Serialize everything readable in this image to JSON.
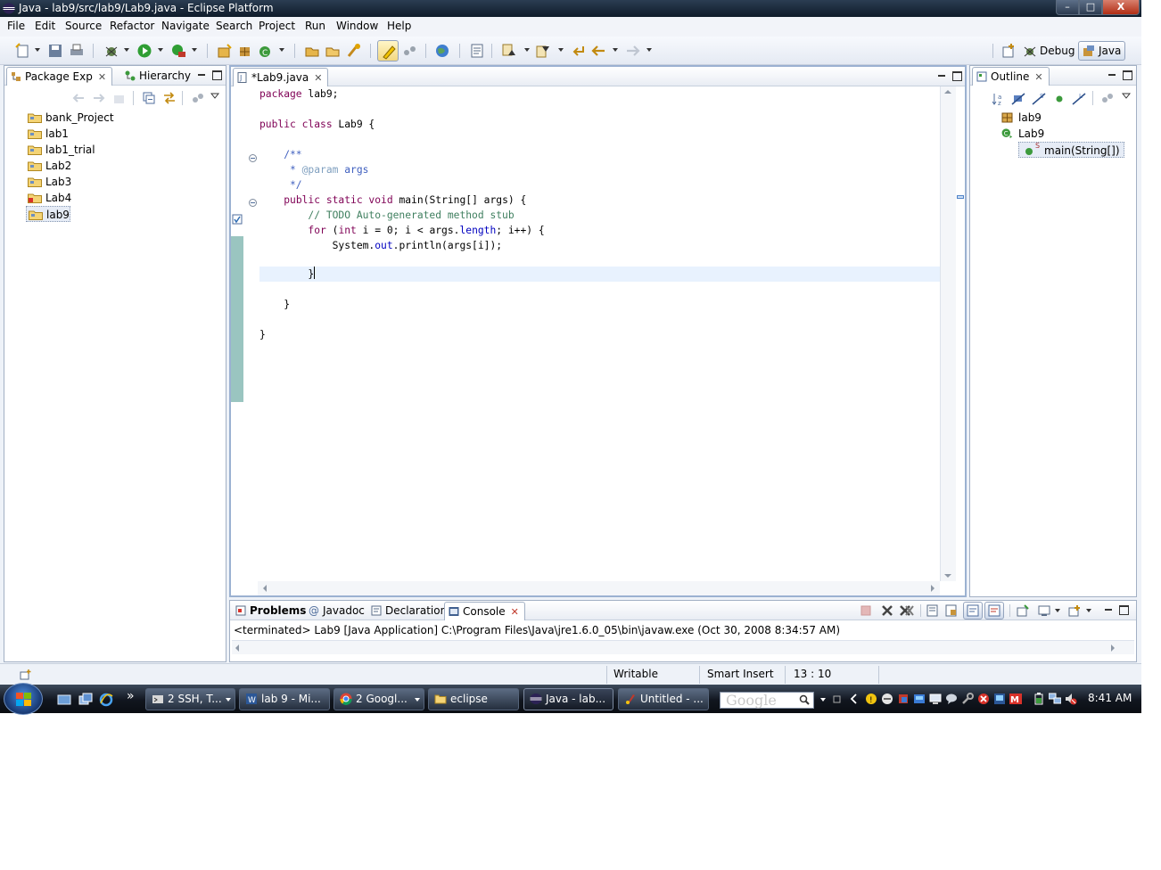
{
  "window": {
    "title": "Java - lab9/src/lab9/Lab9.java - Eclipse Platform",
    "controls": {
      "minimize": "–",
      "maximize": "□",
      "close": "X"
    }
  },
  "menu": [
    "File",
    "Edit",
    "Source",
    "Refactor",
    "Navigate",
    "Search",
    "Project",
    "Run",
    "Window",
    "Help"
  ],
  "perspectives": {
    "debug": "Debug",
    "java": "Java"
  },
  "package_explorer": {
    "tabs": [
      "Package Exp",
      "Hierarchy"
    ],
    "close_glyph": "✕",
    "projects": [
      "bank_Project",
      "lab1",
      "lab1_trial",
      "Lab2",
      "Lab3",
      "Lab4",
      "lab9"
    ],
    "selected": "lab9"
  },
  "editor": {
    "tab": "*Lab9.java",
    "close_glyph": "✕",
    "lines": {
      "l1_kw": "package",
      "l1_rest": " lab9;",
      "l3_kw": "public class",
      "l3_rest": " Lab9 {",
      "l5": "    /**",
      "l6_a": "     * ",
      "l6_tag": "@param",
      "l6_b": " args",
      "l7": "     */",
      "l8_a": "    ",
      "l8_kw": "public static void",
      "l8_rest": " main(String[] args) {",
      "l9": "        // TODO Auto-generated method stub",
      "l10_a": "        ",
      "l10_kw": "for",
      "l10_b": " (",
      "l10_kw2": "int",
      "l10_c": " i = 0; i < args.",
      "l10_fld": "length",
      "l10_d": "; i++) {",
      "l11_a": "            System.",
      "l11_fld": "out",
      "l11_b": ".println(args[i]);",
      "l13": "        }",
      "l15": "    }",
      "l17": "}"
    }
  },
  "outline": {
    "tab": "Outline",
    "close_glyph": "✕",
    "items": [
      "lab9",
      "Lab9",
      "main(String[])"
    ],
    "static_marker": "S"
  },
  "bottom_panel": {
    "tabs": [
      "Problems",
      "Javadoc",
      "Declaration",
      "Console"
    ],
    "close_glyph": "✕",
    "console_header": "<terminated> Lab9 [Java Application] C:\\Program Files\\Java\\jre1.6.0_05\\bin\\javaw.exe (Oct 30, 2008 8:34:57 AM)"
  },
  "status": {
    "writable": "Writable",
    "insert_mode": "Smart Insert",
    "position": "13 : 10"
  },
  "taskbar": {
    "more": "»",
    "buttons": [
      "2 SSH, T...",
      "lab 9 - Mi...",
      "2 Googl...",
      "eclipse",
      "Java - lab...",
      "Untitled - ..."
    ],
    "search_placeholder": "Google",
    "clock": "8:41 AM"
  }
}
